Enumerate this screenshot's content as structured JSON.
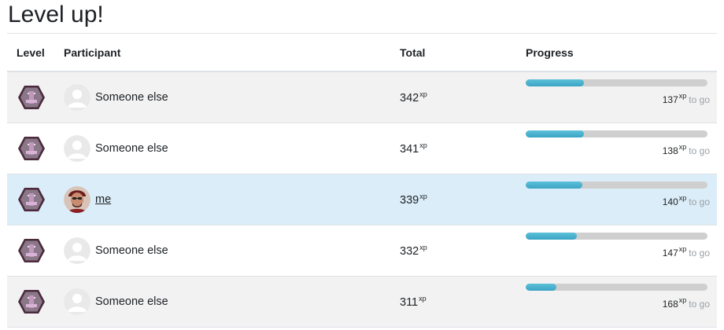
{
  "page": {
    "title": "Level up!"
  },
  "table": {
    "headers": {
      "level": "Level",
      "participant": "Participant",
      "total": "Total",
      "progress": "Progress"
    },
    "xp_suffix": "xp",
    "to_go_label": "to go",
    "rows": [
      {
        "participant": "Someone else",
        "is_me": false,
        "total": "342",
        "remaining": "137",
        "progress_fraction": 0.32
      },
      {
        "participant": "Someone else",
        "is_me": false,
        "total": "341",
        "remaining": "138",
        "progress_fraction": 0.32
      },
      {
        "participant": "me",
        "is_me": true,
        "total": "339",
        "remaining": "140",
        "progress_fraction": 0.31
      },
      {
        "participant": "Someone else",
        "is_me": false,
        "total": "332",
        "remaining": "147",
        "progress_fraction": 0.28
      },
      {
        "participant": "Someone else",
        "is_me": false,
        "total": "311",
        "remaining": "168",
        "progress_fraction": 0.17
      }
    ]
  },
  "colors": {
    "progress_fill": "#3ba4c4",
    "progress_track": "#cfcfcf",
    "highlight_row": "#dbedf8",
    "striped_row": "#f2f2f2"
  },
  "icons": {
    "level": "level-badge-icon",
    "avatar_default": "default-avatar-icon",
    "avatar_me": "user-avatar-photo"
  }
}
